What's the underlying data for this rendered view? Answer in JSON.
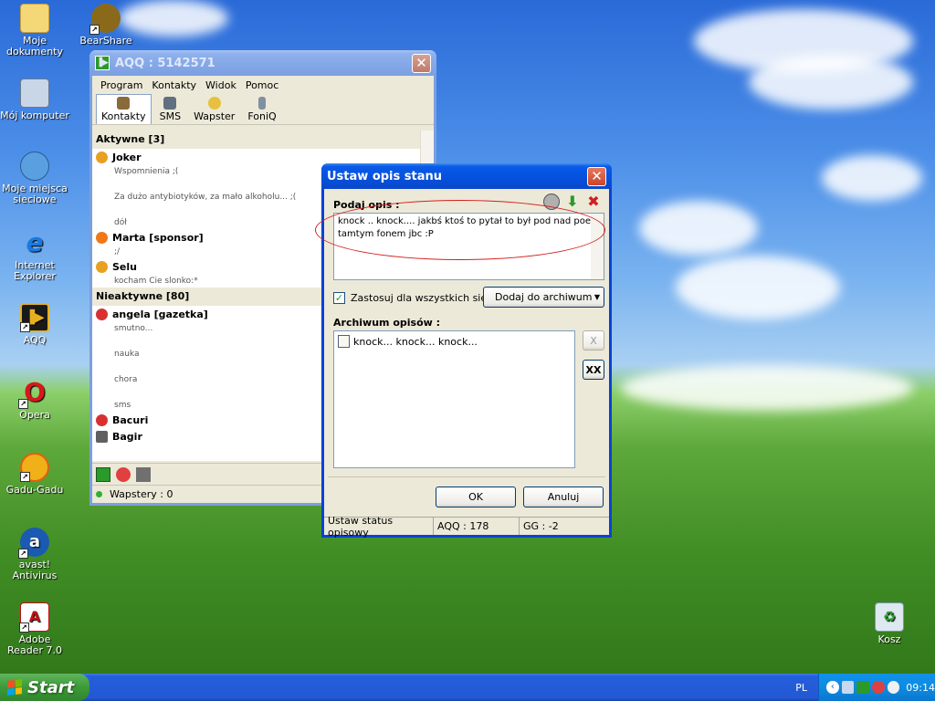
{
  "desktop": {
    "icons": [
      {
        "label": "Moje dokumenty"
      },
      {
        "label": "BearShare"
      },
      {
        "label": "Mój komputer"
      },
      {
        "label": "Moje miejsca sieciowe"
      },
      {
        "label": "Internet Explorer"
      },
      {
        "label": "AQQ"
      },
      {
        "label": "Opera"
      },
      {
        "label": "Gadu-Gadu"
      },
      {
        "label": "avast! Antivirus"
      },
      {
        "label": "Adobe Reader 7.0"
      },
      {
        "label": "Kosz"
      }
    ]
  },
  "aqq": {
    "title": "AQQ : 5142571",
    "menu": [
      "Program",
      "Kontakty",
      "Widok",
      "Pomoc"
    ],
    "tabs": [
      "Kontakty",
      "SMS",
      "Wapster",
      "FoniQ"
    ],
    "groups": [
      {
        "name": "Aktywne [3]"
      },
      {
        "name": "Nieaktywne [80]"
      }
    ],
    "contacts_active": [
      {
        "name": "Joker",
        "desc": [
          "Wspomnienia ;(",
          "Za dużo antybiotyków, za mało alkoholu... ;(",
          "dół"
        ]
      },
      {
        "name": "Marta [sponsor]",
        "desc": [
          ";/"
        ]
      },
      {
        "name": "Selu",
        "desc": [
          "kocham Cie slonko:*"
        ]
      }
    ],
    "contacts_inactive": [
      {
        "name": "angela [gazetka]",
        "desc": [
          "smutno...",
          "nauka",
          "chora",
          "sms"
        ]
      },
      {
        "name": "Bacuri"
      },
      {
        "name": "Bagir"
      }
    ],
    "status": "Wapstery : 0"
  },
  "dialog": {
    "title": "Ustaw opis stanu",
    "prompt_label": "Podaj opis :",
    "description_text": "knock .. knock.... jakbś ktoś to pytał to był pod nad poe tamtym fonem jbc :P",
    "checkbox_label": "Zastosuj dla wszystkich sieci",
    "checkbox_checked": true,
    "archive_button": "Dodaj do archiwum",
    "archive_label": "Archiwum opisów :",
    "archive_items": [
      "knock... knock... knock..."
    ],
    "delete_one": "X",
    "delete_all": "XX",
    "ok": "OK",
    "cancel": "Anuluj",
    "status": [
      "Ustaw status opisowy",
      "AQQ : 178",
      "GG : -2"
    ]
  },
  "taskbar": {
    "start": "Start",
    "lang": "PL",
    "clock": "09:14"
  },
  "colors": {
    "accent": "#0a5ae8",
    "annotation": "#d42020"
  }
}
